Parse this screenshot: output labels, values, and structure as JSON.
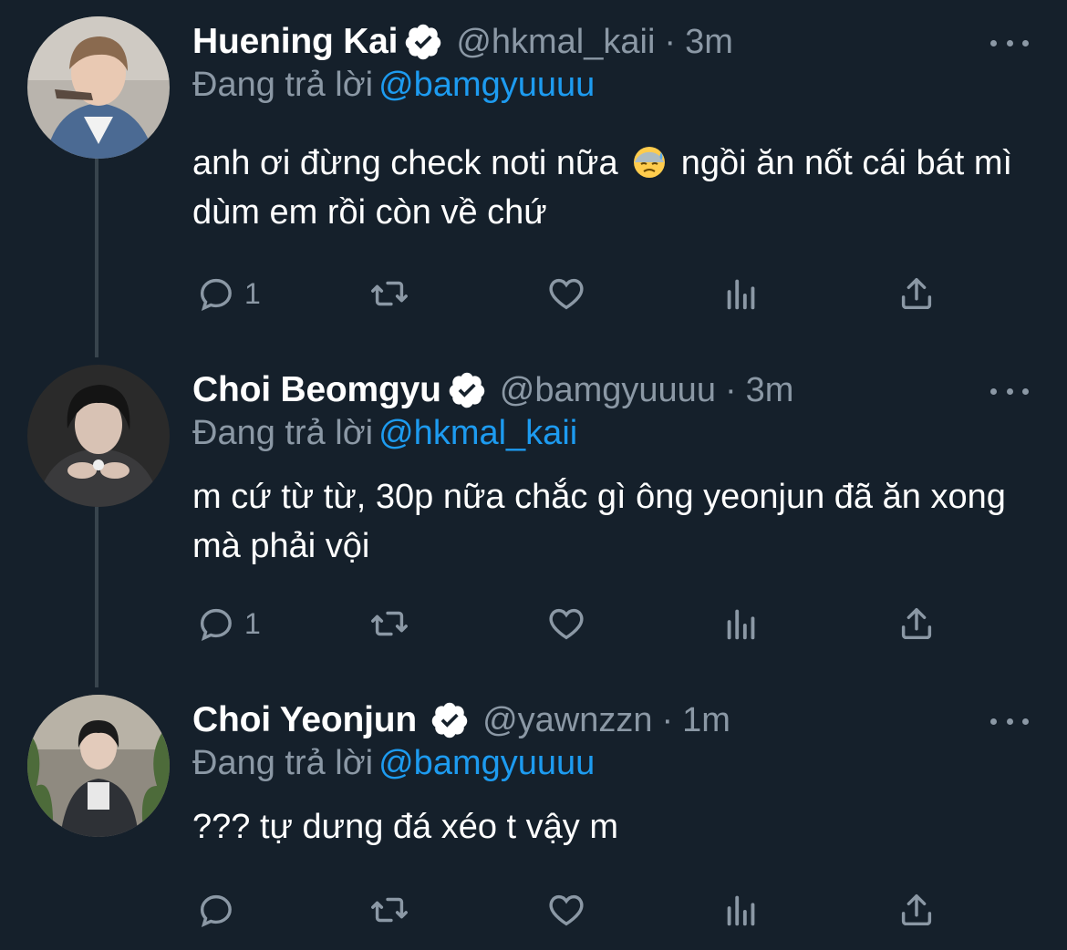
{
  "colors": {
    "background": "#15202b",
    "text": "#ffffff",
    "muted": "#8b98a5",
    "link": "#1d9bf0",
    "verified_badge": "#ffffff"
  },
  "icons": [
    "reply-icon",
    "retweet-icon",
    "like-icon",
    "analytics-icon",
    "share-icon",
    "verified-icon",
    "more-icon",
    "sweat-emoji"
  ],
  "tweets": [
    {
      "name": "Huening Kai",
      "handle": "@hkmal_kaii",
      "separator": "·",
      "time": "3m",
      "replying_label": "Đang trả lời",
      "replying_to": "@bamgyuuuu",
      "text_before_emoji": "anh ơi đừng check noti nữa",
      "emoji": "😓",
      "text_after_emoji": " ngồi ăn nốt cái bát mì dùm em rồi còn về chứ",
      "reply_count": "1"
    },
    {
      "name": "Choi Beomgyu",
      "handle": "@bamgyuuuu",
      "separator": "·",
      "time": "3m",
      "replying_label": "Đang trả lời",
      "replying_to": "@hkmal_kaii",
      "text": "m cứ từ từ, 30p nữa chắc gì ông yeonjun đã ăn xong mà phải vội",
      "reply_count": "1"
    },
    {
      "name": "Choi Yeonjun",
      "handle": "@yawnzzn",
      "separator": "·",
      "time": "1m",
      "replying_label": "Đang trả lời",
      "replying_to": "@bamgyuuuu",
      "text": "??? tự dưng đá xéo t vậy m",
      "reply_count": ""
    }
  ]
}
